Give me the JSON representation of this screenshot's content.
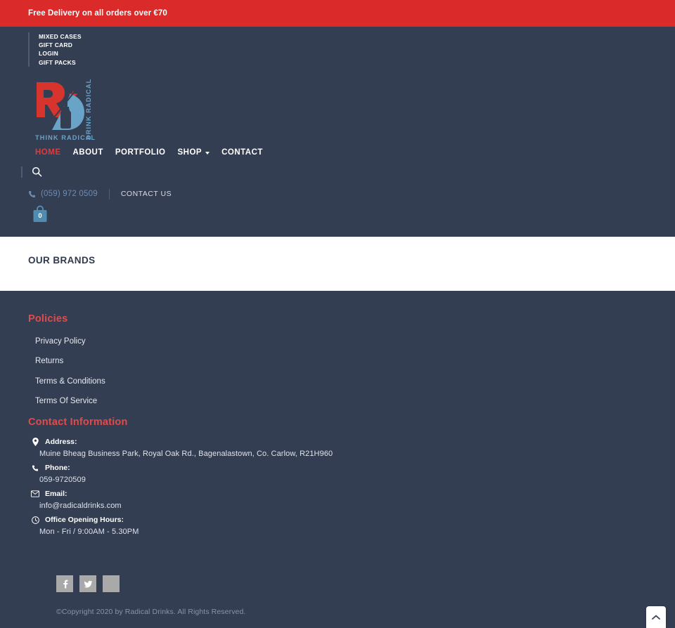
{
  "announcement": {
    "text": "Free Delivery on all orders over €70",
    "bg_color": "#da2a2a"
  },
  "theme": {
    "dark_navy": "#343e52",
    "accent_red": "#e14b4b",
    "link_blue": "#6d8cb4",
    "muted_gray": "#8b93a3"
  },
  "top_menu": {
    "items": [
      {
        "label": "MIXED CASES"
      },
      {
        "label": "GIFT CARD"
      },
      {
        "label": "LOGIN"
      },
      {
        "label": "GIFT PACKS"
      }
    ]
  },
  "logo": {
    "monogram_r": "R",
    "monogram_d": "D",
    "tagline": "THINK RADICAL",
    "vertical_tagline": "DRINK RADICAL",
    "red": "#d8342e",
    "blue": "#6aa3c8"
  },
  "main_nav": {
    "items": [
      {
        "label": "HOME",
        "active": true,
        "has_dropdown": false
      },
      {
        "label": "ABOUT",
        "active": false,
        "has_dropdown": false
      },
      {
        "label": "PORTFOLIO",
        "active": false,
        "has_dropdown": false
      },
      {
        "label": "SHOP",
        "active": false,
        "has_dropdown": true
      },
      {
        "label": "CONTACT",
        "active": false,
        "has_dropdown": false
      }
    ]
  },
  "search": {
    "icon": "search-icon"
  },
  "contact_bar": {
    "phone": "(059) 972 0509",
    "contact_us_label": "CONTACT US",
    "phone_icon": "phone-icon"
  },
  "cart": {
    "count": "0",
    "icon": "shopping-bag-icon"
  },
  "brands_section": {
    "title": "OUR BRANDS"
  },
  "footer": {
    "policies": {
      "heading": "Policies",
      "links": [
        {
          "label": "Privacy Policy"
        },
        {
          "label": "Returns"
        },
        {
          "label": "Terms & Conditions"
        },
        {
          "label": "Terms Of Service"
        }
      ]
    },
    "contact_information": {
      "heading": "Contact Information",
      "rows": [
        {
          "icon": "map-pin-icon",
          "label": "Address:",
          "value": "Muine Bheag Business Park, Royal Oak Rd., Bagenalastown, Co. Carlow, R21H960"
        },
        {
          "icon": "phone-icon",
          "label": "Phone:",
          "value": "059-9720509"
        },
        {
          "icon": "envelope-icon",
          "label": "Email:",
          "value": "info@radicaldrinks.com"
        },
        {
          "icon": "clock-icon",
          "label": "Office Opening Hours:",
          "value": "Mon - Fri / 9:00AM - 5.30PM"
        }
      ]
    },
    "social": [
      {
        "name": "facebook-icon",
        "glyph": "f"
      },
      {
        "name": "twitter-icon",
        "glyph": "t"
      },
      {
        "name": "blank-social-icon",
        "glyph": ""
      }
    ],
    "copyright": "©Copyright 2020 by Radical Drinks. All Rights Reserved."
  },
  "scroll_top": {
    "icon": "chevron-up-icon"
  }
}
